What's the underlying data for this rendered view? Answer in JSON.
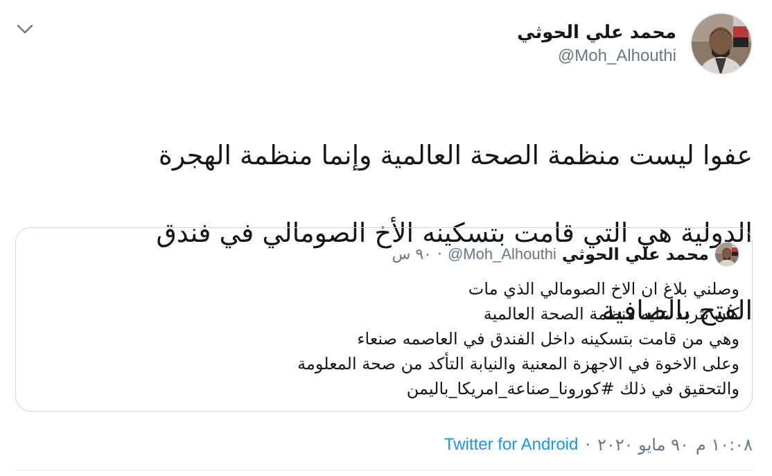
{
  "author": {
    "name": "محمد علي الحوثي",
    "handle": "@Moh_Alhouthi"
  },
  "tweet": {
    "text_lines": [
      "عفوا ليست منظمة الصحة العالمية وإنما منظمة الهجرة",
      "الدولية هي التي قامت بتسكينه الأخ الصومالي في فندق",
      "الفتح بالصافية"
    ]
  },
  "quote": {
    "name": "محمد علي الحوثي",
    "handle": "@Moh_Alhouthi",
    "separator": "·",
    "time": "٩٠ س",
    "lines": [
      "وصلني بلاغ ان الاخ الصومالي الذي مات",
      "كان تتردد عليه منظمة الصحة العالمية",
      "وهي من قامت بتسكينه داخل الفندق في العاصمه صنعاء",
      "وعلى الاخوة في الاجهزة المعنية والنيابة التأكد من صحة المعلومة",
      "والتحقيق في ذلك #كورونا_صناعة_امريكا_باليمن"
    ]
  },
  "meta": {
    "time": "١٠:٠٨ م",
    "date": "٩٠ مايو ٢٠٢٠",
    "separator": "·",
    "source": "Twitter for Android"
  },
  "icons": {
    "menu": "chevron-down-icon"
  },
  "colors": {
    "link": "#1b95e0",
    "secondary": "#657786",
    "border": "#ccd6dd"
  }
}
